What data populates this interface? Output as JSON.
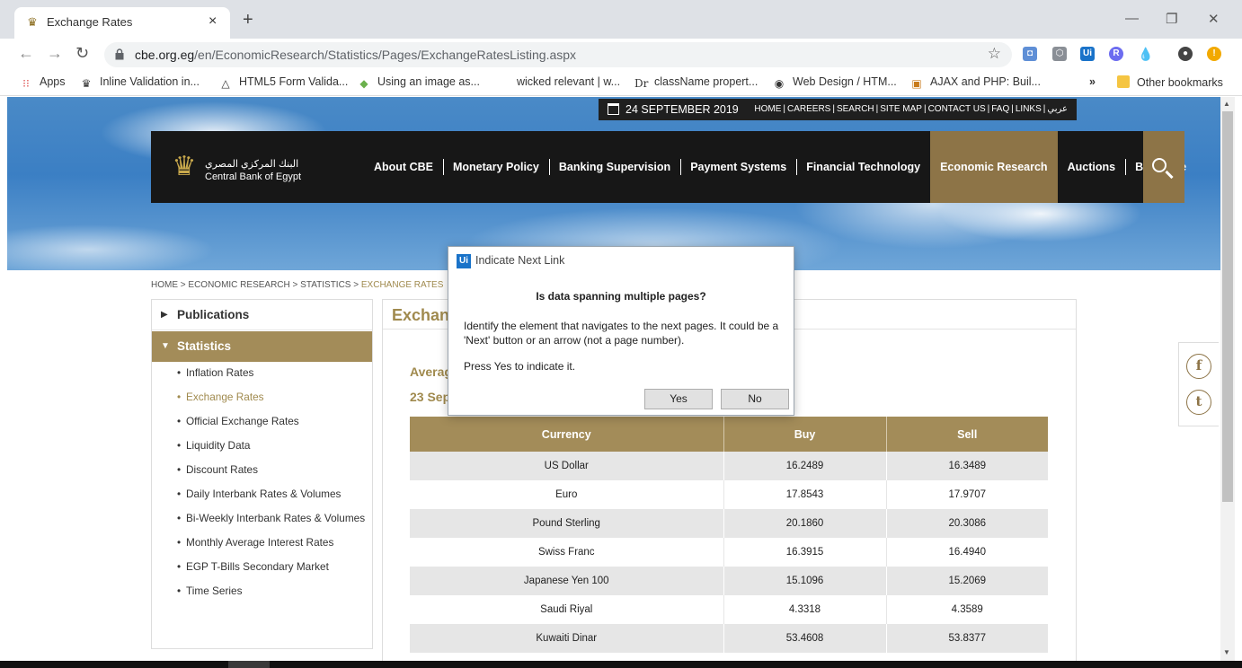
{
  "browser": {
    "tab_title": "Exchange Rates",
    "tab_close": "×",
    "new_tab": "+",
    "window_controls": [
      "—",
      "❐",
      "✕"
    ],
    "nav": {
      "back": "←",
      "forward": "→",
      "reload": "↻"
    },
    "url_host": "cbe.org.eg",
    "url_path": "/en/EconomicResearch/Statistics/Pages/ExchangeRatesListing.aspx",
    "star": "☆",
    "bookmarks": [
      {
        "label": "Apps",
        "icon": "apps-grid-icon"
      },
      {
        "label": "Inline Validation in...",
        "icon": "validation-icon"
      },
      {
        "label": "HTML5 Form Valida...",
        "icon": "html5-icon"
      },
      {
        "label": "Using an image as...",
        "icon": "image-icon"
      },
      {
        "label": "wicked relevant | w...",
        "icon": ""
      },
      {
        "label": "className propert...",
        "icon": "dr-icon"
      },
      {
        "label": "Web Design / HTM...",
        "icon": "globe-icon"
      },
      {
        "label": "AJAX and PHP: Buil...",
        "icon": "book-icon"
      }
    ],
    "bookmarks_more": "»",
    "other_bookmarks": "Other bookmarks"
  },
  "site": {
    "date": "24 SEPTEMBER 2019",
    "top_links": [
      "HOME",
      "CAREERS",
      "SEARCH",
      "SITE MAP",
      "CONTACT US",
      "FAQ",
      "LINKS",
      "عربي"
    ],
    "logo_ar": "البنك المركزي المصري",
    "logo_en": "Central Bank of Egypt",
    "menu": [
      "About CBE",
      "Monetary Policy",
      "Banking Supervision",
      "Payment Systems",
      "Financial Technology",
      "Economic Research",
      "Auctions",
      "Banknote"
    ],
    "active_menu_index": 5,
    "accent_color": "#a38c59",
    "breadcrumb": {
      "home": "HOME",
      "section": "ECONOMIC RESEARCH",
      "sub": "STATISTICS",
      "current": "EXCHANGE RATES",
      "sep": " > "
    }
  },
  "sidebar": {
    "publications": "Publications",
    "statistics": "Statistics",
    "items": [
      "Inflation Rates",
      "Exchange Rates",
      "Official Exchange Rates",
      "Liquidity Data",
      "Discount Rates",
      "Daily Interbank Rates & Volumes",
      "Bi-Weekly Interbank Rates & Volumes",
      "Monthly Average Interest Rates",
      "EGP T-Bills Secondary Market",
      "Time Series"
    ],
    "selected_index": 1
  },
  "content": {
    "title": "Exchang",
    "avg_title": "Averag",
    "avg_date": "23 Sep",
    "table": {
      "headers": [
        "Currency",
        "Buy",
        "Sell"
      ],
      "rows": [
        [
          "US Dollar",
          "16.2489",
          "16.3489"
        ],
        [
          "Euro",
          "17.8543",
          "17.9707"
        ],
        [
          "Pound Sterling",
          "20.1860",
          "20.3086"
        ],
        [
          "Swiss Franc",
          "16.3915",
          "16.4940"
        ],
        [
          "Japanese Yen 100",
          "15.1096",
          "15.2069"
        ],
        [
          "Saudi Riyal",
          "4.3318",
          "4.3589"
        ],
        [
          "Kuwaiti Dinar",
          "53.4608",
          "53.8377"
        ]
      ]
    }
  },
  "social": {
    "facebook": "f",
    "twitter": "t"
  },
  "dialog": {
    "logo": "Ui",
    "title": "Indicate Next Link",
    "question": "Is data spanning multiple pages?",
    "body": "Identify the element that navigates to the next pages. It could be a 'Next' button or an arrow (not a page number).",
    "hint": "Press Yes to indicate it.",
    "yes": "Yes",
    "no": "No"
  }
}
